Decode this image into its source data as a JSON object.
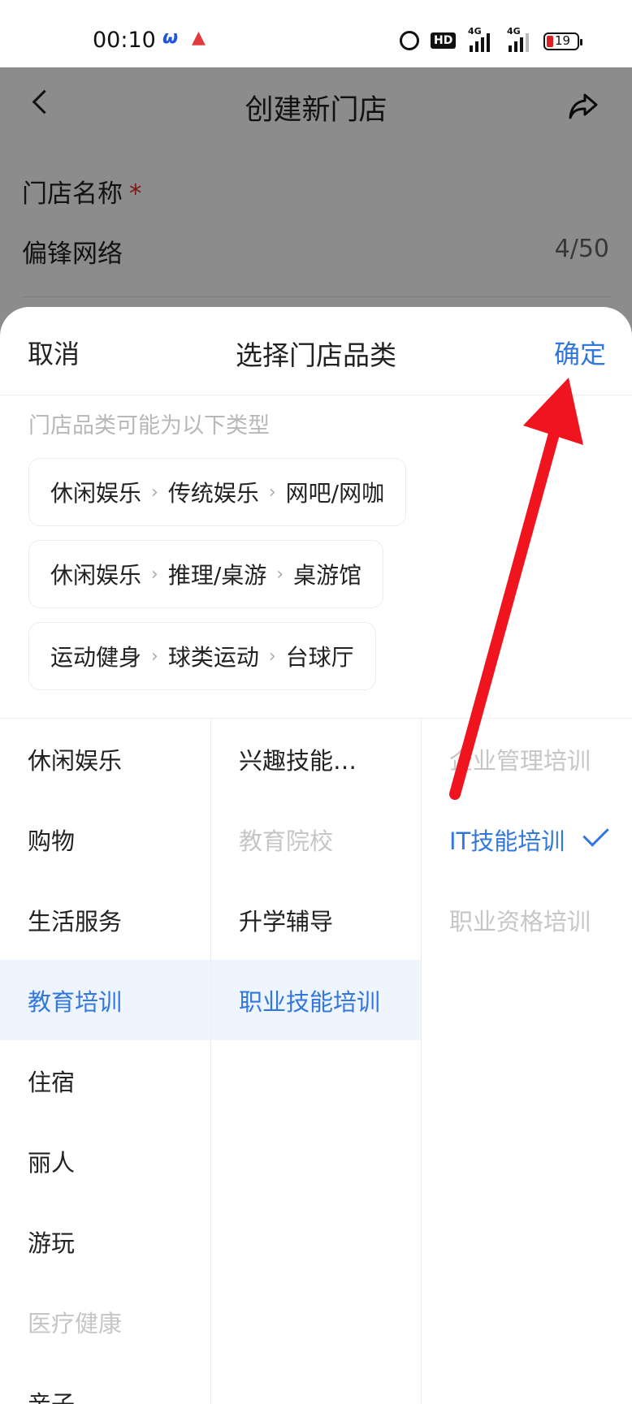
{
  "status_bar": {
    "time": "00:10",
    "battery": "19",
    "network_1": "4G",
    "network_2": "4G",
    "hd_label": "HD",
    "icons": [
      "app-icon-blue",
      "app-icon-red",
      "alarm-icon",
      "hd-icon",
      "signal-icon",
      "signal-icon",
      "battery-icon"
    ]
  },
  "page": {
    "title": "创建新门店",
    "field_label": "门店名称",
    "required_mark": "*",
    "field_value": "偏锋网络",
    "field_count": "4/50"
  },
  "sheet": {
    "cancel": "取消",
    "title": "选择门店品类",
    "confirm": "确定",
    "hint": "门店品类可能为以下类型",
    "suggestions": [
      [
        "休闲娱乐",
        "传统娱乐",
        "网吧/网咖"
      ],
      [
        "休闲娱乐",
        "推理/桌游",
        "桌游馆"
      ],
      [
        "运动健身",
        "球类运动",
        "台球厅"
      ]
    ],
    "level1": [
      {
        "label": "休闲娱乐",
        "state": "normal"
      },
      {
        "label": "购物",
        "state": "normal"
      },
      {
        "label": "生活服务",
        "state": "normal"
      },
      {
        "label": "教育培训",
        "state": "selected"
      },
      {
        "label": "住宿",
        "state": "normal"
      },
      {
        "label": "丽人",
        "state": "normal"
      },
      {
        "label": "游玩",
        "state": "normal"
      },
      {
        "label": "医疗健康",
        "state": "disabled"
      },
      {
        "label": "亲子",
        "state": "normal"
      }
    ],
    "level2": [
      {
        "label": "兴趣技能培...",
        "state": "normal"
      },
      {
        "label": "教育院校",
        "state": "disabled"
      },
      {
        "label": "升学辅导",
        "state": "normal"
      },
      {
        "label": "职业技能培训",
        "state": "selected"
      }
    ],
    "level3": [
      {
        "label": "企业管理培训",
        "state": "disabled"
      },
      {
        "label": "IT技能培训",
        "state": "checked"
      },
      {
        "label": "职业资格培训",
        "state": "disabled"
      }
    ],
    "chip_separator": "›"
  },
  "colors": {
    "accent": "#3377dd",
    "annotation_arrow": "#f0141e",
    "required": "#e03030"
  }
}
